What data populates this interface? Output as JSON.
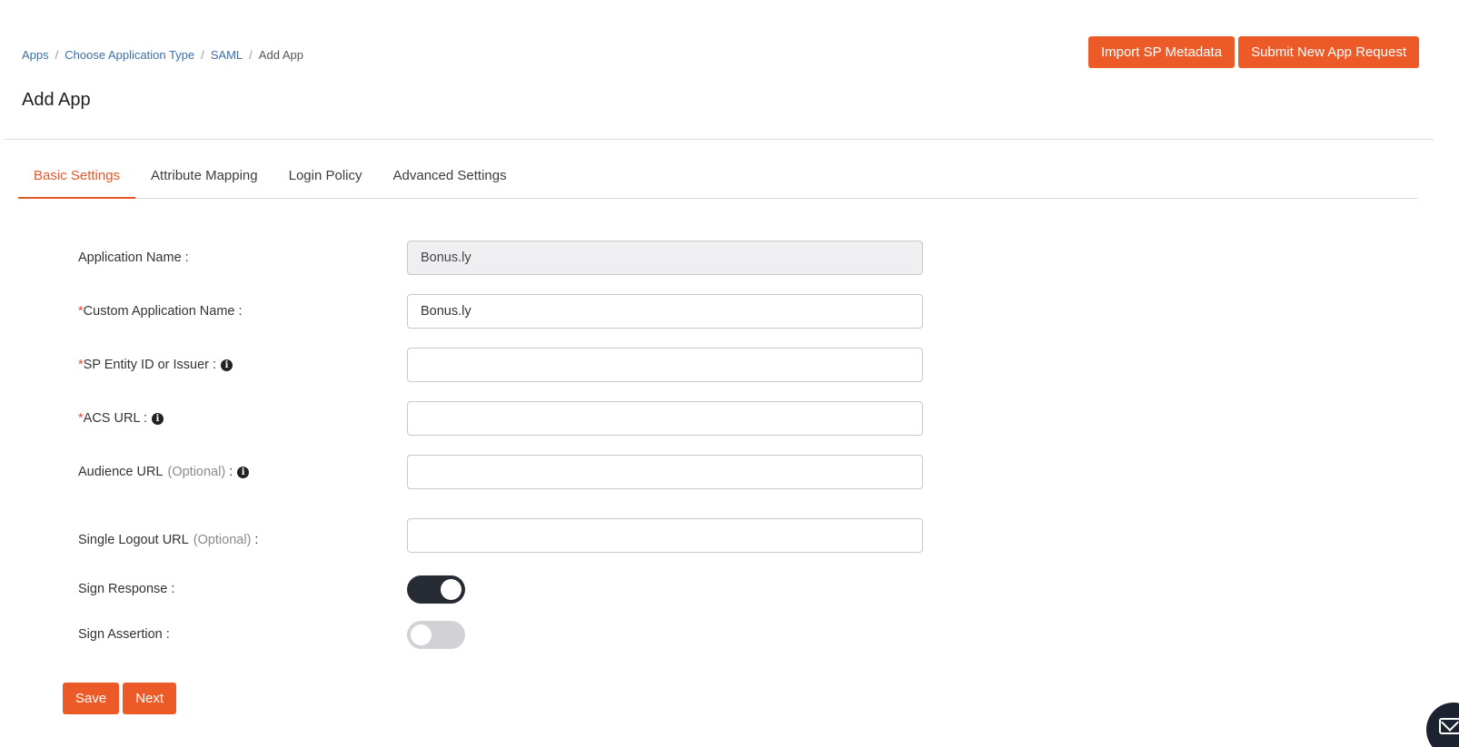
{
  "breadcrumb": {
    "items": [
      "Apps",
      "Choose Application Type",
      "SAML"
    ],
    "current": "Add App"
  },
  "page_title": "Add App",
  "header_actions": {
    "import_label": "Import SP Metadata",
    "submit_label": "Submit New App Request"
  },
  "tabs": [
    {
      "label": "Basic Settings",
      "active": true
    },
    {
      "label": "Attribute Mapping",
      "active": false
    },
    {
      "label": "Login Policy",
      "active": false
    },
    {
      "label": "Advanced Settings",
      "active": false
    }
  ],
  "form": {
    "application_name": {
      "label": "Application Name :",
      "value": "Bonus.ly"
    },
    "custom_application_name": {
      "required_mark": "*",
      "label": "Custom Application Name :",
      "value": "Bonus.ly"
    },
    "sp_entity_id": {
      "required_mark": "*",
      "label": "SP Entity ID or Issuer :",
      "value": ""
    },
    "acs_url": {
      "required_mark": "*",
      "label": "ACS URL :",
      "value": ""
    },
    "audience_url": {
      "label": "Audience URL",
      "optional": "(Optional)",
      "suffix": ":",
      "value": ""
    },
    "single_logout_url": {
      "label": "Single Logout URL",
      "optional": "(Optional)",
      "suffix": ":",
      "value": ""
    },
    "sign_response": {
      "label": "Sign Response :",
      "enabled": true
    },
    "sign_assertion": {
      "label": "Sign Assertion :",
      "enabled": false
    }
  },
  "form_actions": {
    "save_label": "Save",
    "next_label": "Next"
  },
  "icons": {
    "info": "info-circle-icon",
    "chat": "envelope-icon"
  },
  "colors": {
    "accent": "#ec5a28",
    "toggle_on": "#262b34",
    "toggle_off": "#d2d2d6"
  }
}
